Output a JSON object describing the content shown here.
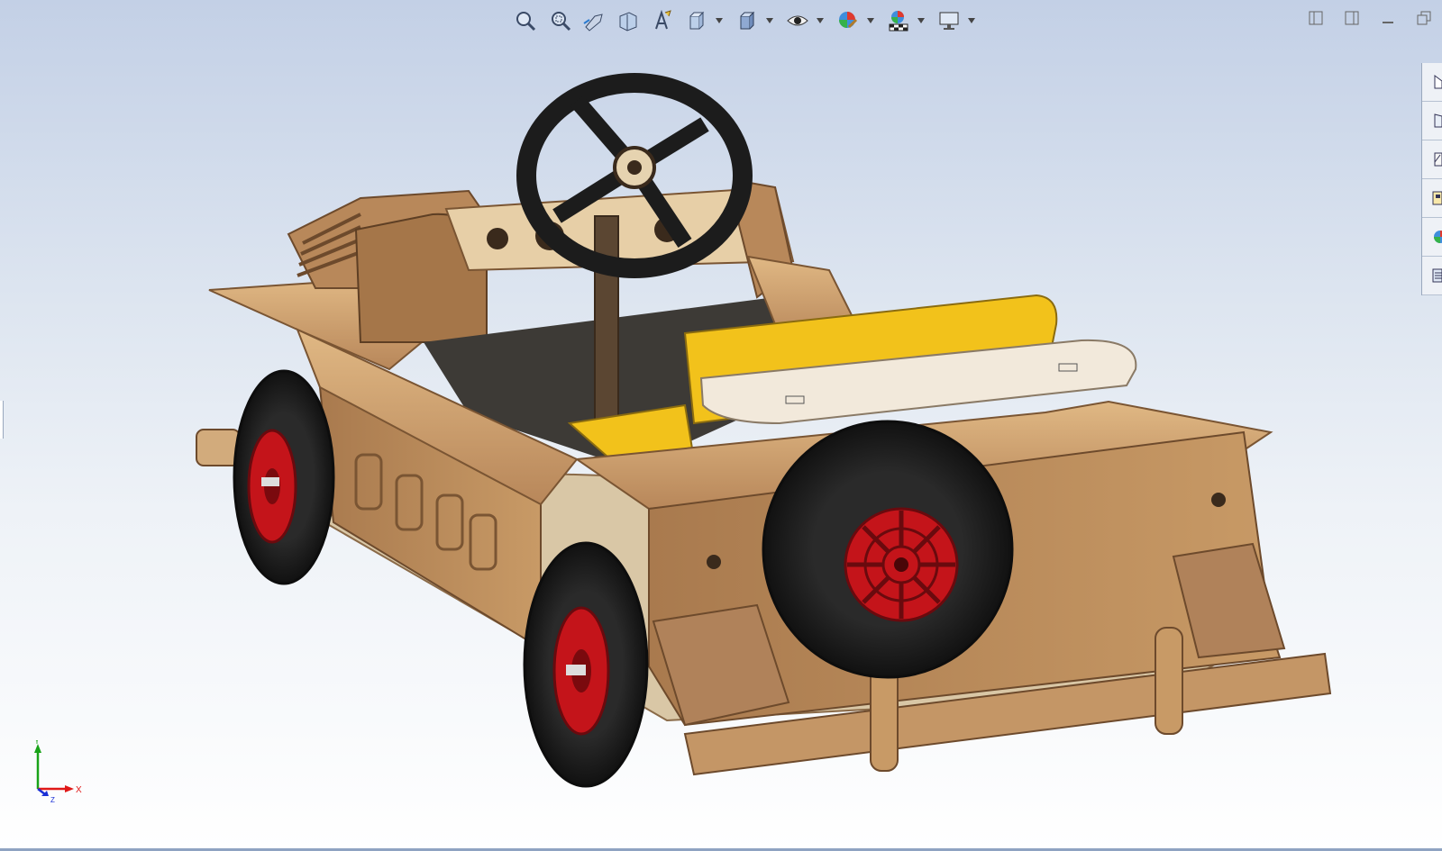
{
  "heads_up_toolbar": {
    "items": [
      {
        "icon": "zoom-to-fit-icon",
        "dropdown": false
      },
      {
        "icon": "zoom-to-area-icon",
        "dropdown": false
      },
      {
        "icon": "previous-view-icon",
        "dropdown": false
      },
      {
        "icon": "section-view-icon",
        "dropdown": false
      },
      {
        "icon": "dynamic-annotation-views-icon",
        "dropdown": false
      },
      {
        "icon": "view-orientation-icon",
        "dropdown": true
      },
      {
        "icon": "display-style-icon",
        "dropdown": true
      },
      {
        "icon": "hide-show-items-icon",
        "dropdown": true
      },
      {
        "icon": "edit-appearance-icon",
        "dropdown": true
      },
      {
        "icon": "apply-scene-icon",
        "dropdown": true
      },
      {
        "icon": "view-settings-icon",
        "dropdown": true
      }
    ]
  },
  "window_controls": [
    "split-left-icon",
    "split-right-icon",
    "minimize-icon",
    "restore-icon"
  ],
  "task_pane": {
    "tabs": [
      "solidworks-resources-icon",
      "design-library-icon",
      "file-explorer-icon",
      "view-palette-icon",
      "appearances-scenes-icon",
      "custom-properties-icon"
    ]
  },
  "triad": {
    "x_label": "X",
    "y_label": "Y",
    "z_label": "Z",
    "x_color": "#e01818",
    "y_color": "#19a319",
    "z_color": "#1a2fd6"
  },
  "model": {
    "colors": {
      "plywood": "#c89a66",
      "plywood_dark": "#9a6e44",
      "tire": "#1f1f1f",
      "rim": "#c4141a",
      "seat": "#f2c21b"
    }
  }
}
